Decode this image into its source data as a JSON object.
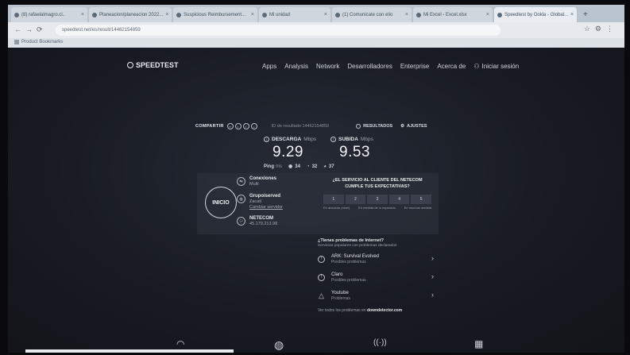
{
  "browser": {
    "tabs": [
      {
        "label": "(8) rafaelalmagro.ci.."
      },
      {
        "label": "Planeacion/planeacion 2022..."
      },
      {
        "label": "Suspicious Reimbursement..."
      },
      {
        "label": "Mi unidad"
      },
      {
        "label": "(1) Comunicate con elio"
      },
      {
        "label": "Mi Excel - Excel.xlsx"
      },
      {
        "label": "Speedtest by Ookla - Global..."
      }
    ],
    "url": "speedtest.net/es/result/14462154859",
    "bookmark": "Product Bookmarks"
  },
  "site": {
    "logo": "SPEEDTEST",
    "nav": [
      "Apps",
      "Analysis",
      "Network",
      "Desarrolladores",
      "Enterprise",
      "Acerca de"
    ],
    "login": "Iniciar sesión",
    "share_label": "COMPARTIR",
    "result_id": "ID de resultado 14462154859",
    "results_link": "RESULTADOS",
    "settings_link": "AJUSTES",
    "download": {
      "label": "DESCARGA",
      "unit": "Mbps",
      "value": "9.29"
    },
    "upload": {
      "label": "SUBIDA",
      "unit": "Mbps",
      "value": "9.53"
    },
    "ping": {
      "label": "Ping",
      "unit": "ms",
      "idle": "34",
      "download": "32",
      "upload": "37"
    },
    "go_label": "INICIO",
    "connections": {
      "title": "Conexiones",
      "value": "Multi"
    },
    "server": {
      "title": "Grupoiserved",
      "location": "Zacatl",
      "change": "Cambiar servidor"
    },
    "isp": {
      "title": "NETECOM",
      "ip": "45.179.213.98"
    },
    "survey": {
      "question": "¿EL SERVICIO AL CLIENTE DEL NETECOM CUMPLE TUS EXPECTATIVAS?",
      "options": [
        "1",
        "2",
        "3",
        "4",
        "5"
      ],
      "low_label": "En absoluto (nivel)",
      "mid_label": "En medida de lo esperado",
      "high_label": "En muchas medida"
    },
    "issues": {
      "heading": "¿Tienes problemas de Internet?",
      "subheading": "Servicios populares con problemas declarados",
      "items": [
        {
          "name": "ARK: Survival Evolved",
          "desc": "Posibles problemas"
        },
        {
          "name": "Claro",
          "desc": "Posibles problemas"
        },
        {
          "name": "Youtube",
          "desc": "Problemas"
        }
      ],
      "more_prefix": "Ver todos los problemas en",
      "more_link": "downdetector.com"
    }
  }
}
